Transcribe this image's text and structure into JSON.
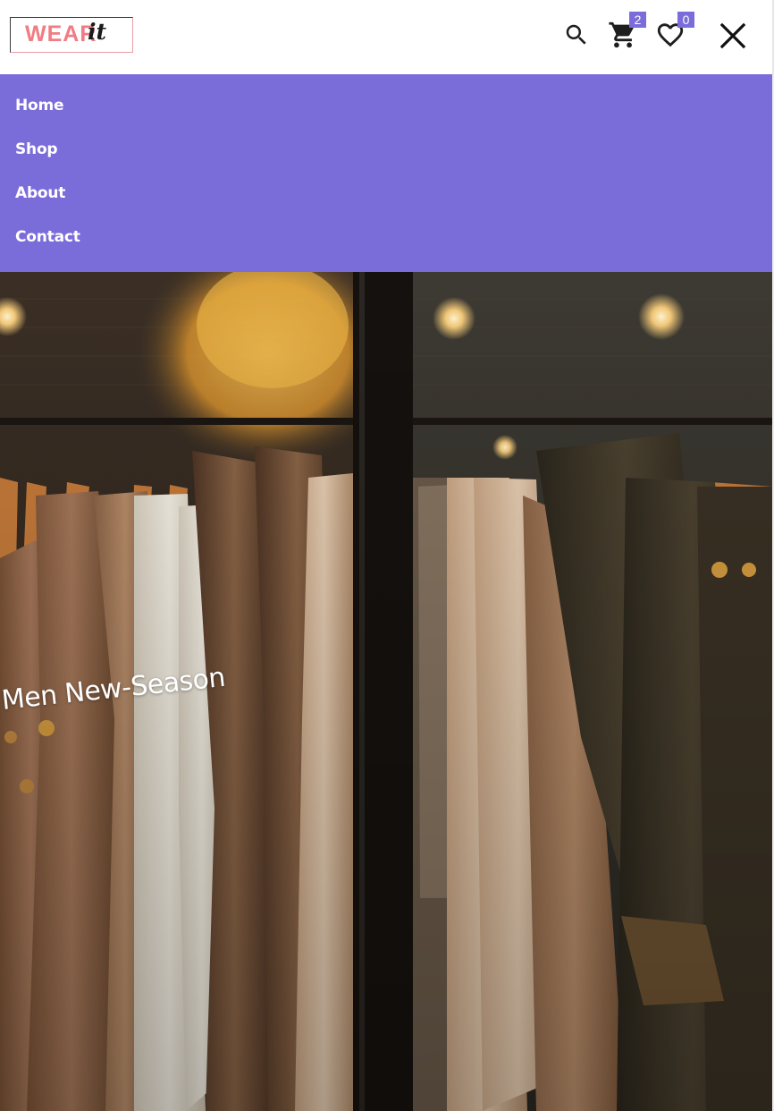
{
  "header": {
    "logo": {
      "text_main": "WEAR",
      "text_script": "it"
    },
    "icons": {
      "search": "search-icon",
      "cart": "cart-icon",
      "wishlist": "heart-icon",
      "close": "close-icon"
    },
    "cart_count": "2",
    "wishlist_count": "0"
  },
  "nav": {
    "items": [
      {
        "label": "Home"
      },
      {
        "label": "Shop"
      },
      {
        "label": "About"
      },
      {
        "label": "Contact"
      }
    ]
  },
  "hero": {
    "caption": "Men New-Season"
  },
  "colors": {
    "accent": "#7b6dd9",
    "logo_pink": "#f07c84",
    "nav_text": "#ffffff"
  }
}
